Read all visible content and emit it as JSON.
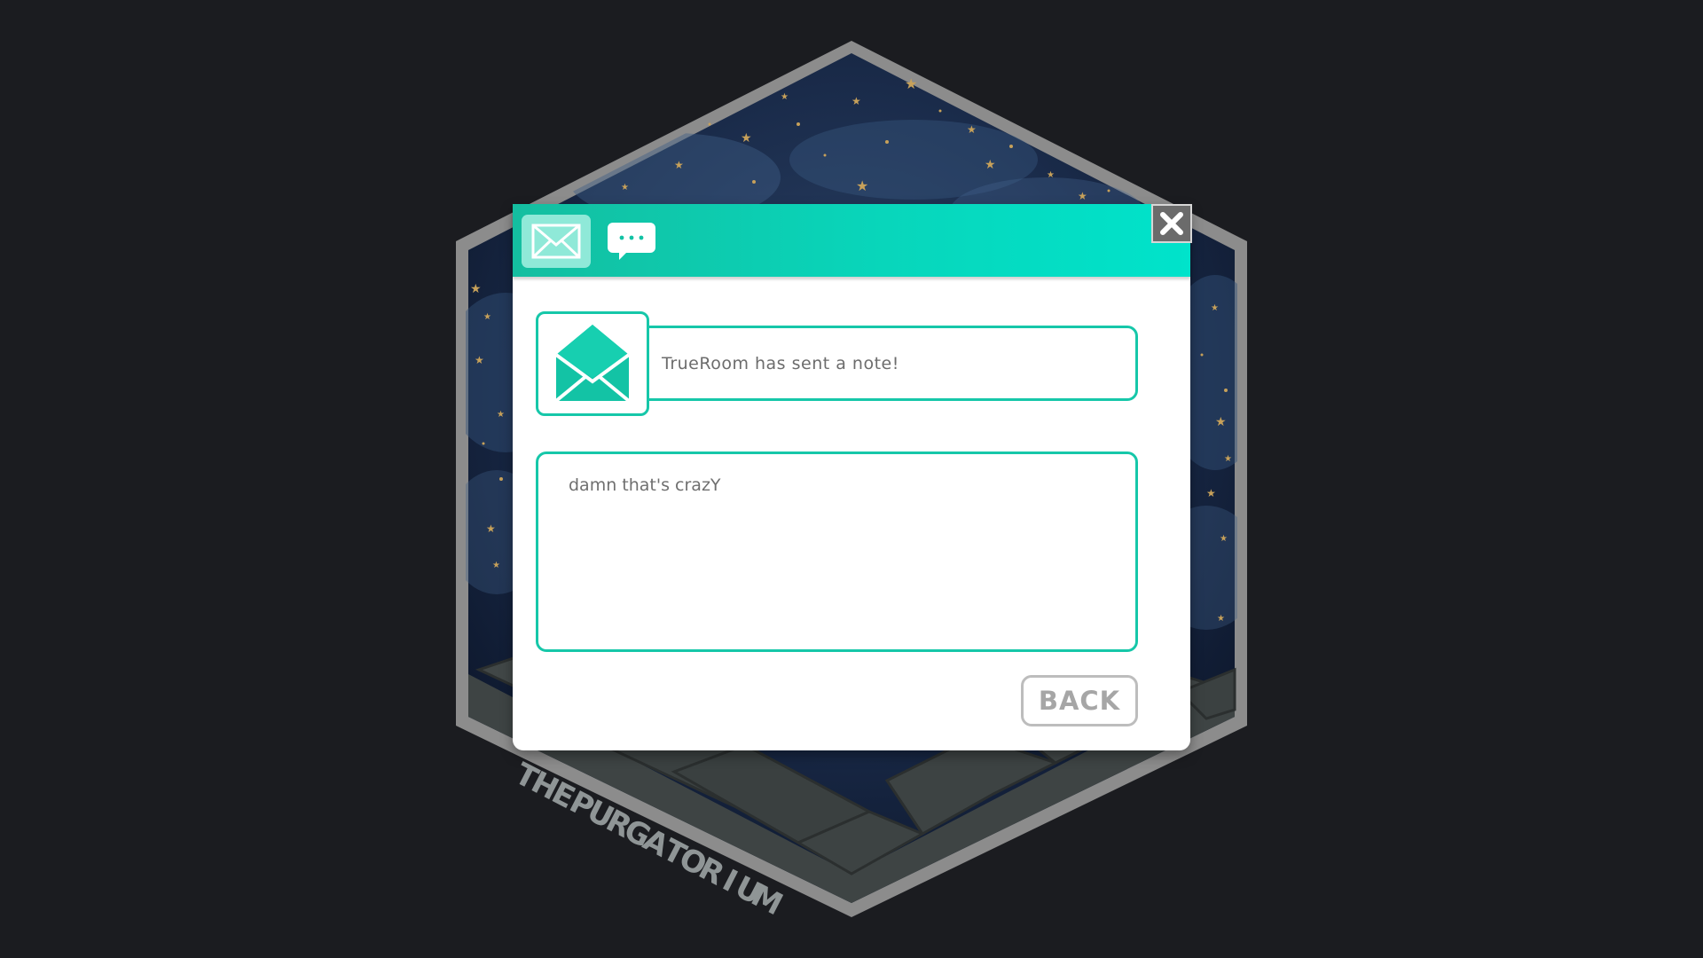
{
  "room": {
    "name": "THEPURGATORIUM",
    "icon": "hexagon-room-icon"
  },
  "dialog": {
    "tabs": [
      {
        "label": "Mail",
        "icon": "envelope-icon",
        "active": true
      },
      {
        "label": "Chat",
        "icon": "chat-bubble-icon",
        "active": false
      }
    ],
    "close_icon": "close-icon",
    "sender_message": "TrueRoom has sent a note!",
    "note_body": "damn that's crazY",
    "back_label": "BACK"
  },
  "colors": {
    "background": "#1b1c20",
    "accent": "#16c7a9",
    "header_start": "#14bea0",
    "header_end": "#00e3cb",
    "text_gray": "#6c6c6c",
    "button_gray": "#a6a6a6"
  }
}
